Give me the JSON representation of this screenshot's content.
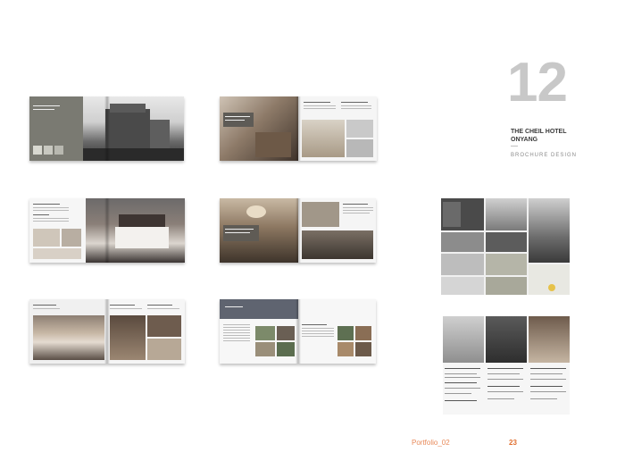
{
  "project": {
    "number": "12",
    "title_line1": "THE CHEIL HOTEL",
    "title_line2": "ONYANG",
    "subtitle": "BROCHURE DESIGN"
  },
  "footer": {
    "portfolio_label": "Portfolio_02",
    "page_number": "23"
  },
  "colors": {
    "accent": "#e07030",
    "number_gray": "#c8c8c8"
  }
}
